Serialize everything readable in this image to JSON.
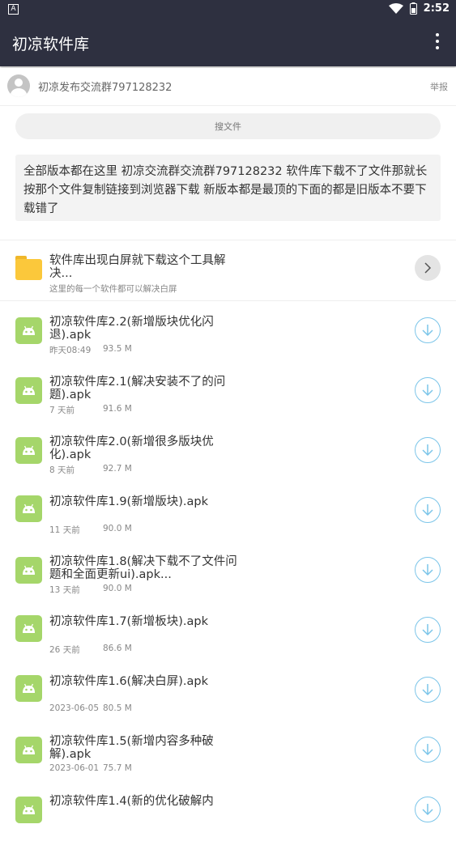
{
  "status_bar": {
    "notification_glyph": "A",
    "time": "2:52",
    "icons": [
      "wifi-icon",
      "battery-icon"
    ]
  },
  "app_bar": {
    "title": "初凉软件库",
    "menu_icon": "more-vert-icon"
  },
  "uploader": {
    "name": "初凉发布交流群797128232",
    "report_label": "举报"
  },
  "search": {
    "placeholder": "搜文件"
  },
  "notice": {
    "text": "全部版本都在这里 初凉交流群交流群797128232 软件库下载不了文件那就长按那个文件复制链接到浏览器下载 新版本都是最顶的下面的都是旧版本不要下载错了"
  },
  "folder": {
    "name": "软件库出现白屏就下载这个工具解决...",
    "subtitle": "这里的每一个软件都可以解决白屏",
    "icon": "folder-icon"
  },
  "files": [
    {
      "name": "初凉软件库2.2(新增版块优化闪退).apk",
      "date": "昨天08:49",
      "size": "93.5 M"
    },
    {
      "name": "初凉软件库2.1(解决安装不了的问题).apk",
      "date": "7 天前",
      "size": "91.6 M"
    },
    {
      "name": "初凉软件库2.0(新增很多版块优化).apk",
      "date": "8 天前",
      "size": "92.7 M"
    },
    {
      "name": "初凉软件库1.9(新增版块).apk",
      "date": "11 天前",
      "size": "90.0 M"
    },
    {
      "name": "初凉软件库1.8(解决下载不了文件问题和全面更新ui).apk...",
      "date": "13 天前",
      "size": "90.0 M"
    },
    {
      "name": "初凉软件库1.7(新增板块).apk",
      "date": "26 天前",
      "size": "86.6 M"
    },
    {
      "name": "初凉软件库1.6(解决白屏).apk",
      "date": "2023-06-05",
      "size": "80.5 M"
    },
    {
      "name": "初凉软件库1.5(新增内容多种破解).apk",
      "date": "2023-06-01",
      "size": "75.7 M"
    },
    {
      "name": "初凉软件库1.4(新的优化破解内",
      "date": "",
      "size": ""
    }
  ],
  "colors": {
    "app_bar": "#2e3040",
    "apk_icon": "#a5d66a",
    "download_ring": "#7cc5e9",
    "folder": "#fbc83b"
  }
}
